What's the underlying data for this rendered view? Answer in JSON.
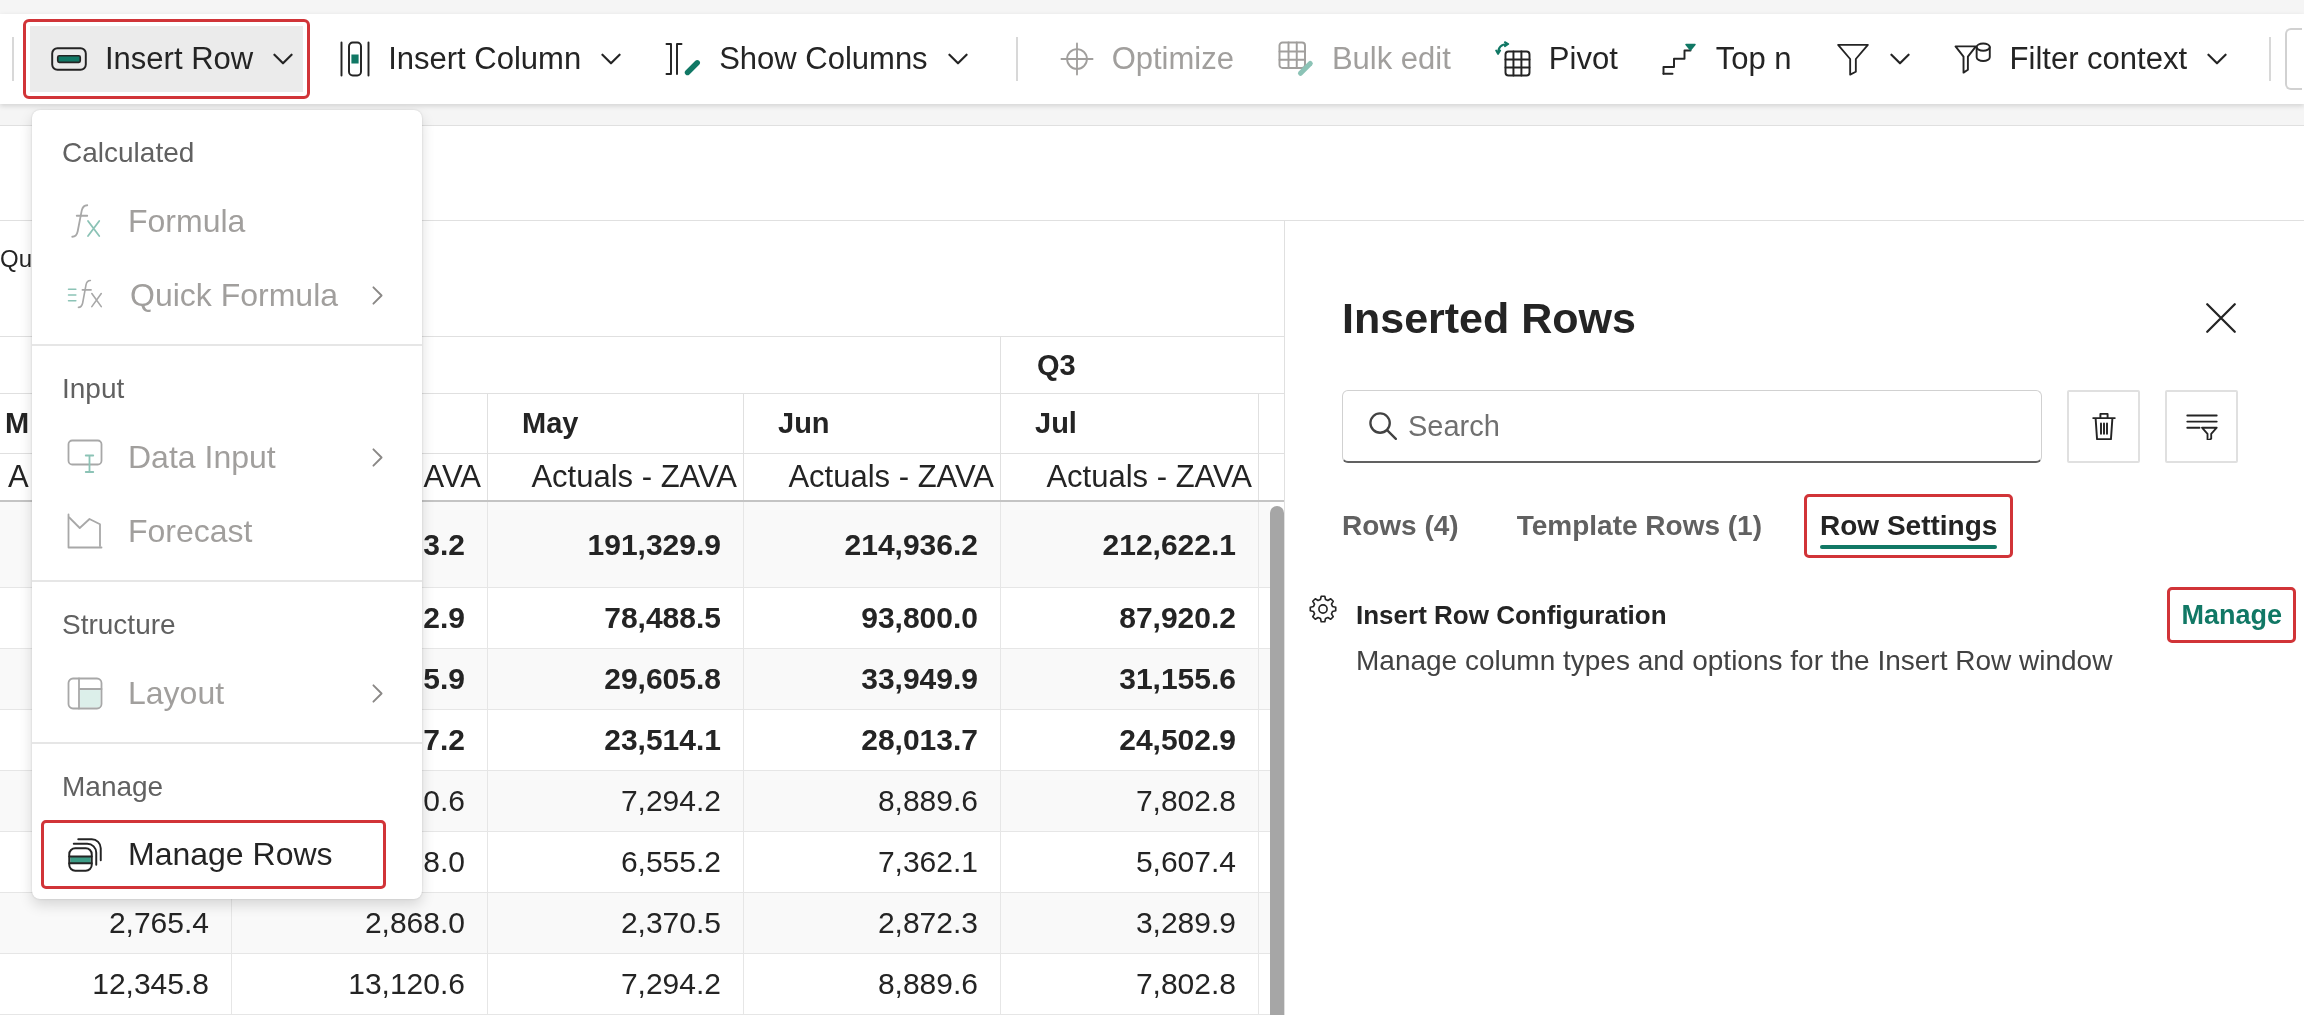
{
  "toolbar": {
    "groups": [
      {
        "items": [
          {
            "kind": "ribbon",
            "label": "Insert Row",
            "dropdown": true,
            "disabled": false,
            "pressed": true,
            "highlighted": true
          },
          {
            "kind": "ribbon",
            "label": "Insert Column",
            "dropdown": true,
            "disabled": false,
            "pressed": false,
            "highlighted": false
          },
          {
            "kind": "ribbon",
            "label": "Show Columns",
            "dropdown": true,
            "disabled": false,
            "pressed": false,
            "highlighted": false
          }
        ]
      },
      {
        "items": [
          {
            "kind": "ribbon",
            "label": "Optimize",
            "dropdown": false,
            "disabled": true,
            "pressed": false,
            "highlighted": false
          },
          {
            "kind": "ribbon",
            "label": "Bulk edit",
            "dropdown": false,
            "disabled": true,
            "pressed": false,
            "highlighted": false
          },
          {
            "kind": "ribbon",
            "label": "Pivot",
            "dropdown": false,
            "disabled": false,
            "pressed": false,
            "highlighted": false
          },
          {
            "kind": "ribbon",
            "label": "Top n",
            "dropdown": false,
            "disabled": false,
            "pressed": false,
            "highlighted": false
          },
          {
            "kind": "ribbon",
            "dropdown": true,
            "disabled": false,
            "pressed": false,
            "highlighted": false
          },
          {
            "kind": "ribbon",
            "label": "Filter context",
            "dropdown": true,
            "disabled": false,
            "pressed": false,
            "highlighted": false
          }
        ]
      },
      {
        "items": [
          {
            "kind": "boxed"
          }
        ]
      }
    ]
  },
  "menu": {
    "sections": [
      {
        "heading": "Calculated",
        "items": [
          {
            "label": "Formula",
            "disabled": true,
            "submenu": false,
            "highlighted": false
          },
          {
            "label": "Quick Formula",
            "disabled": true,
            "submenu": true,
            "highlighted": false
          }
        ]
      },
      {
        "heading": "Input",
        "items": [
          {
            "label": "Data Input",
            "disabled": true,
            "submenu": true,
            "highlighted": false
          },
          {
            "label": "Forecast",
            "disabled": true,
            "submenu": false,
            "highlighted": false
          }
        ]
      },
      {
        "heading": "Structure",
        "items": [
          {
            "label": "Layout",
            "disabled": true,
            "submenu": true,
            "highlighted": false
          }
        ]
      },
      {
        "heading": "Manage",
        "items": [
          {
            "label": "Manage Rows",
            "disabled": false,
            "submenu": false,
            "highlighted": true
          }
        ]
      }
    ]
  },
  "table": {
    "banner": "Qu",
    "columns": [
      {
        "month": "M",
        "measure": "A"
      },
      {
        "measure": "AVA"
      },
      {
        "month": "May",
        "measure": "Actuals - ZAVA"
      },
      {
        "month": "Jun",
        "measure": "Actuals - ZAVA"
      },
      {
        "quarter": "Q3",
        "month": "Jul",
        "measure": "Actuals - ZAVA"
      }
    ],
    "rows": [
      {
        "total": true,
        "cells": [
          null,
          "3.2",
          "191,329.9",
          "214,936.2",
          "212,622.1"
        ]
      },
      {
        "total": true,
        "cells": [
          null,
          "2.9",
          "78,488.5",
          "93,800.0",
          "87,920.2"
        ]
      },
      {
        "total": true,
        "cells": [
          null,
          "5.9",
          "29,605.8",
          "33,949.9",
          "31,155.6"
        ]
      },
      {
        "total": true,
        "cells": [
          null,
          "7.2",
          "23,514.1",
          "28,013.7",
          "24,502.9"
        ]
      },
      {
        "total": false,
        "cells": [
          null,
          "0.6",
          "7,294.2",
          "8,889.6",
          "7,802.8"
        ]
      },
      {
        "total": false,
        "cells": [
          null,
          "8.0",
          "6,555.2",
          "7,362.1",
          "5,607.4"
        ]
      },
      {
        "total": false,
        "cells": [
          "2,765.4",
          "2,868.0",
          "2,370.5",
          "2,872.3",
          "3,289.9"
        ]
      },
      {
        "total": false,
        "cells": [
          "12,345.8",
          "13,120.6",
          "7,294.2",
          "8,889.6",
          "7,802.8"
        ]
      }
    ]
  },
  "panel": {
    "title": "Inserted Rows",
    "search": {
      "placeholder": "Search"
    },
    "tabs": [
      {
        "label": "Rows (4)",
        "selected": false,
        "highlighted": false
      },
      {
        "label": "Template Rows (1)",
        "selected": false,
        "highlighted": false
      },
      {
        "label": "Row Settings",
        "selected": true,
        "highlighted": true
      }
    ],
    "settings": [
      {
        "title": "Insert Row Configuration",
        "description": "Manage column types and options for the Insert Row window",
        "action": {
          "label": "Manage",
          "highlighted": true
        }
      }
    ]
  }
}
